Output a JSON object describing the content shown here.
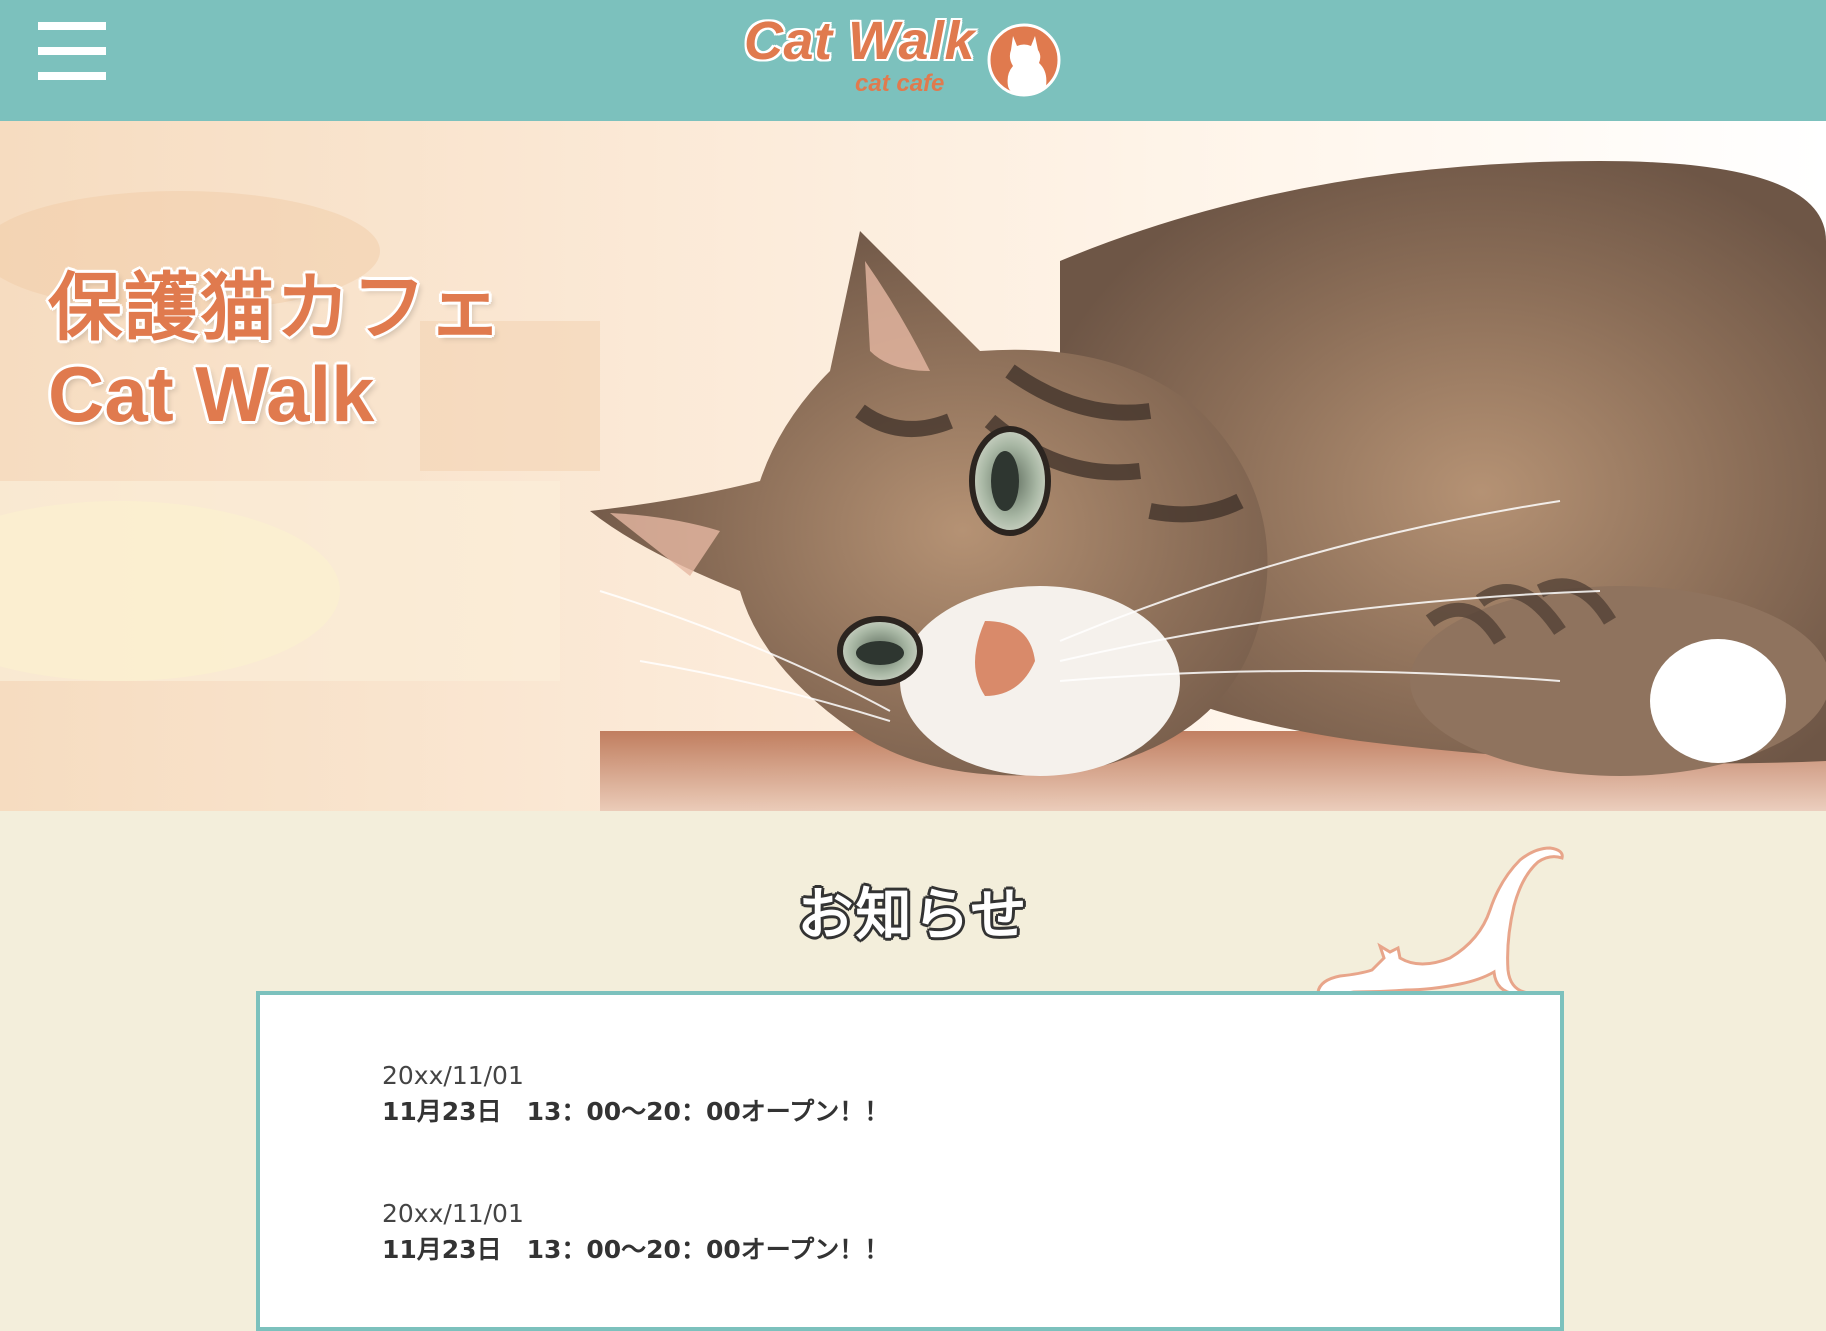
{
  "header": {
    "menu_icon": "hamburger-menu-icon",
    "logo_title": "Cat Walk",
    "logo_subtitle": "cat cafe",
    "logo_icon": "cat-silhouette-icon",
    "bg_color": "#7cc1bd",
    "accent_color": "#e07a4e"
  },
  "hero": {
    "line1": "保護猫カフェ",
    "line2": "Cat Walk",
    "image": "tabby-cat-lying-photo"
  },
  "news": {
    "heading": "お知らせ",
    "decoration_icon": "stretching-cat-icon",
    "items": [
      {
        "date": "20xx/11/01",
        "title": "11月23日　13：00～20：00オープン！！"
      },
      {
        "date": "20xx/11/01",
        "title": "11月23日　13：00～20：00オープン！！"
      }
    ]
  }
}
